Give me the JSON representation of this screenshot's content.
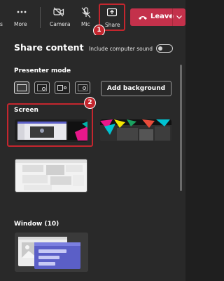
{
  "toolbar": {
    "more_label": "More",
    "camera_label": "Camera",
    "mic_label": "Mic",
    "share_label": "Share",
    "leave_label": "Leave"
  },
  "panel": {
    "title": "Share content",
    "include_sound_label": "Include computer sound",
    "presenter_mode_label": "Presenter mode",
    "add_background_label": "Add background",
    "screen_label": "Screen",
    "window_label": "Window (10)"
  },
  "annotations": {
    "badge_1": "1",
    "badge_2": "2"
  },
  "colors": {
    "accent_red": "#c4262e",
    "leave_button": "#c4314b"
  }
}
